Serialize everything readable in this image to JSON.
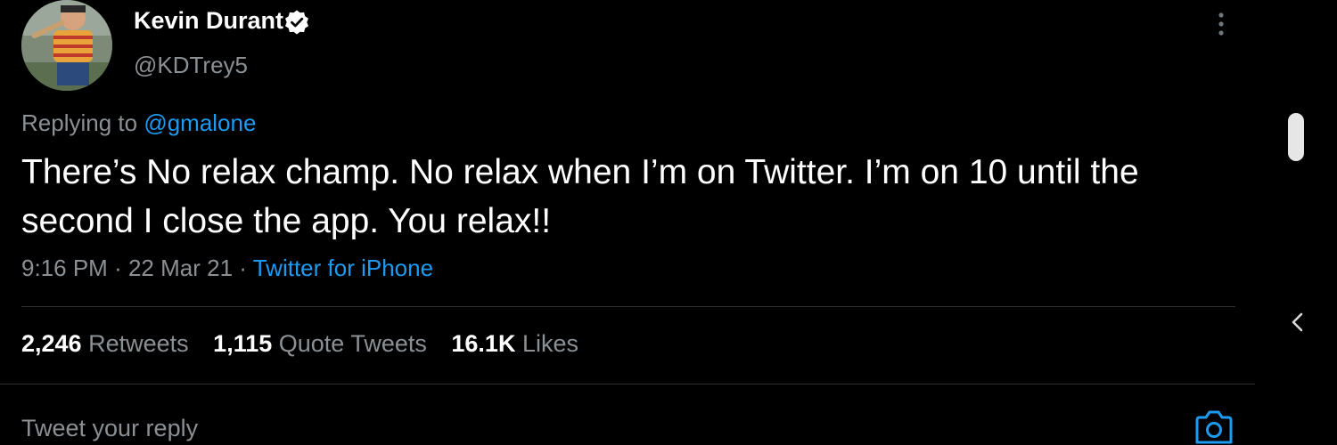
{
  "tweet": {
    "author": {
      "display_name": "Kevin Durant",
      "handle": "@KDTrey5",
      "verified": true,
      "avatar_icon": "avatar-photo"
    },
    "replying_to_prefix": "Replying to",
    "replying_to_handle": "@gmalone",
    "text": "There’s No relax champ. No relax when I’m on Twitter. I’m on 10 until the second I close the app. You relax!!",
    "time": "9:16 PM",
    "separator": "·",
    "date": "22 Mar 21",
    "source": "Twitter for iPhone",
    "stats": [
      {
        "count": "2,246",
        "label": "Retweets"
      },
      {
        "count": "1,115",
        "label": "Quote Tweets"
      },
      {
        "count": "16.1K",
        "label": "Likes"
      }
    ]
  },
  "reply_box": {
    "placeholder": "Tweet your reply"
  },
  "icons": {
    "verified": "verified-badge-icon",
    "more": "more-vertical-icon",
    "back": "chevron-left-icon",
    "camera": "camera-icon"
  },
  "colors": {
    "background": "#000000",
    "text_primary": "#ffffff",
    "text_secondary": "#8b9094",
    "accent": "#1d9bf0",
    "divider": "#2f3336"
  }
}
